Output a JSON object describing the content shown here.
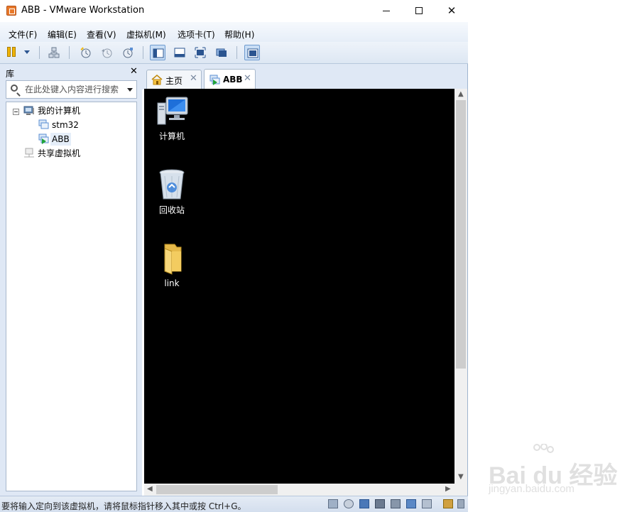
{
  "window": {
    "title": "ABB - VMware Workstation",
    "controls": {
      "minimize": "—",
      "maximize": "☐",
      "close": "✕"
    }
  },
  "menu": [
    "文件(F)",
    "编辑(E)",
    "查看(V)",
    "虚拟机(M)",
    "选项卡(T)",
    "帮助(H)"
  ],
  "library": {
    "title": "库",
    "close": "✕",
    "search_placeholder": "在此处键入内容进行搜索",
    "tree": {
      "root": "我的计算机",
      "vms": [
        "stm32",
        "ABB"
      ],
      "shared": "共享虚拟机"
    }
  },
  "tabs": [
    {
      "label": "主页",
      "icon": "home-icon",
      "close": "✕"
    },
    {
      "label": "ABB",
      "icon": "vm-running-icon",
      "close": "✕"
    }
  ],
  "desktop": {
    "icons": [
      {
        "label": "计算机",
        "icon": "computer-icon"
      },
      {
        "label": "回收站",
        "icon": "recycle-bin-icon"
      },
      {
        "label": "link",
        "icon": "folder-icon"
      }
    ]
  },
  "status": {
    "text": "要将输入定向到该虚拟机，请将鼠标指针移入其中或按 Ctrl+G。"
  },
  "watermark": {
    "brand": "Bai du 经验",
    "url": "jingyan.baidu.com"
  },
  "colors": {
    "vm_screen": "#000000",
    "chrome": "#dfe8f5",
    "accent": "#2b5590"
  }
}
